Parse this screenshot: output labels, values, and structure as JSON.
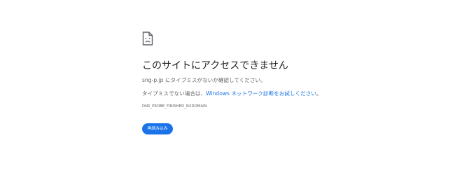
{
  "icon": "sad-page-icon",
  "title": "このサイトにアクセスできません",
  "message": {
    "line1": "sng-p.jp にタイプミスがないか確認してください。",
    "line2_prefix": "タイプミスでない場合は、",
    "line2_link": "Windows ネットワーク診断をお試しください",
    "line2_suffix": "。"
  },
  "error_code": "DNS_PROBE_FINISHED_NXDOMAIN",
  "reload_button_label": "再読み込み",
  "colors": {
    "accent": "#1a73e8",
    "text": "#202124",
    "secondary_text": "#5f6368",
    "background": "#ffffff"
  }
}
